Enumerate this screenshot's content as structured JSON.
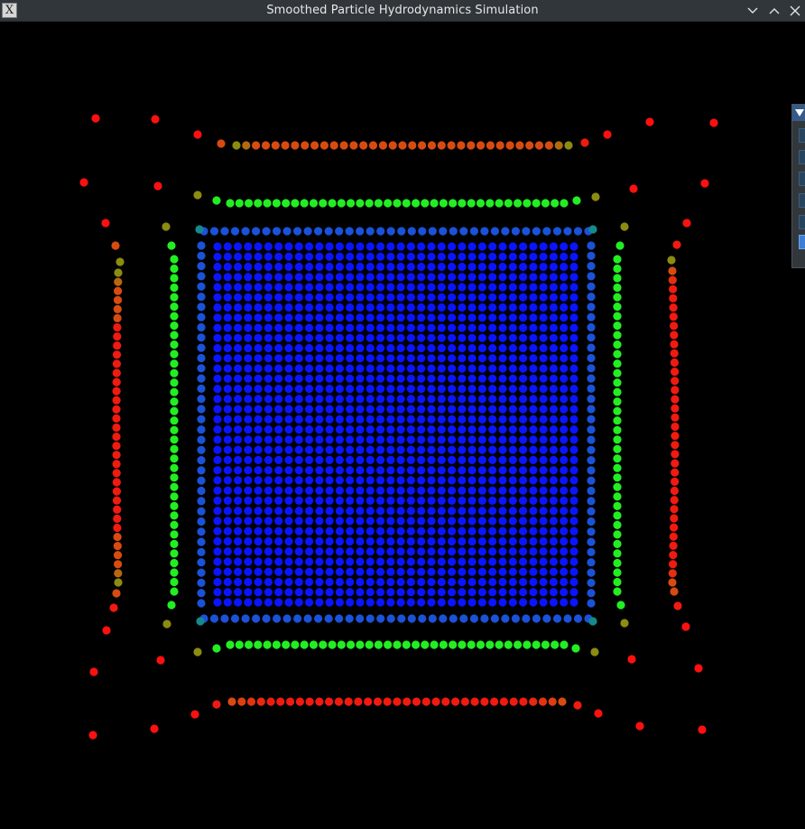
{
  "window": {
    "title": "Smoothed Particle Hydrodynamics Simulation",
    "icon": "x11-app-icon",
    "controls": [
      "minimize-icon",
      "maximize-icon",
      "close-icon"
    ]
  },
  "colors": {
    "background": "#000000",
    "titlebar": "#31363b",
    "panel_header": "#365a8a",
    "low_density": "#0a14ff",
    "mid_density": "#1fe81f",
    "high_density": "#ff1a0a"
  },
  "panel": {
    "collapse_icon": "triangle-down-icon",
    "rows": 6
  }
}
